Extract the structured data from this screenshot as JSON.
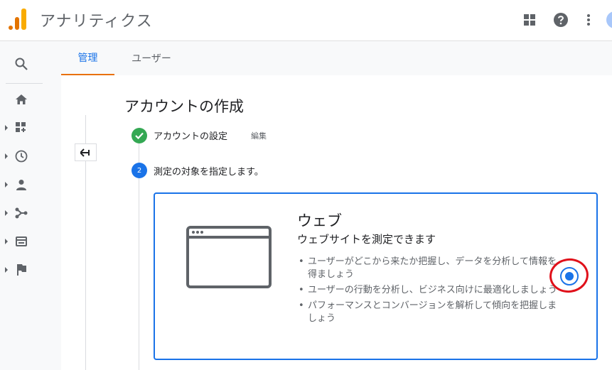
{
  "header": {
    "app_title": "アナリティクス",
    "icons": [
      "apps-grid-icon",
      "help-icon",
      "more-vert-icon"
    ]
  },
  "sidenav": {
    "items": [
      "search-icon",
      "home-icon",
      "customization-icon",
      "realtime-icon",
      "audience-icon",
      "acquisition-icon",
      "behavior-icon",
      "conversions-icon"
    ]
  },
  "tabs": [
    {
      "label": "管理",
      "active": true
    },
    {
      "label": "ユーザー",
      "active": false
    }
  ],
  "page": {
    "title": "アカウントの作成",
    "steps": [
      {
        "number": "",
        "label": "アカウントの設定",
        "edit_label": "編集",
        "status": "complete"
      },
      {
        "number": "2",
        "label": "測定の対象を指定します。",
        "status": "active"
      }
    ]
  },
  "card": {
    "title": "ウェブ",
    "subtitle": "ウェブサイトを測定できます",
    "bullets": [
      "ユーザーがどこから来たか把握し、データを分析して情報を得ましょう",
      "ユーザーの行動を分析し、ビジネス向けに最適化しましょう",
      "パフォーマンスとコンバージョンを解析して傾向を把握しましょう"
    ],
    "selected": true
  },
  "colors": {
    "accent": "#1a73e8",
    "tab_indicator": "#e8710a",
    "success": "#34a853",
    "annotation": "#e0101a"
  }
}
